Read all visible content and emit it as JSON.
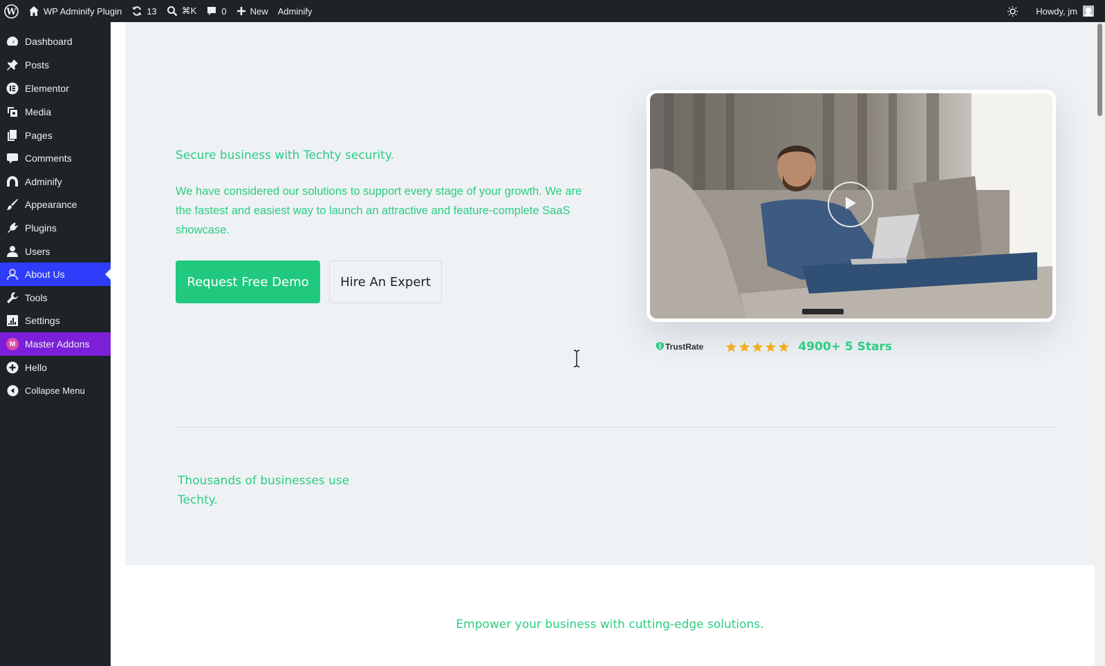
{
  "adminbar": {
    "site_name": "WP Adminify Plugin",
    "updates_count": "13",
    "search_shortcut": "⌘K",
    "comments_count": "0",
    "new_label": "New",
    "adminify_label": "Adminify",
    "greeting": "Howdy, jm"
  },
  "sidebar": {
    "items": [
      {
        "label": "Dashboard",
        "icon": "dashboard-icon"
      },
      {
        "label": "Posts",
        "icon": "pushpin-icon"
      },
      {
        "label": "Elementor",
        "icon": "elementor-icon"
      },
      {
        "label": "Media",
        "icon": "media-icon"
      },
      {
        "label": "Pages",
        "icon": "pages-icon"
      },
      {
        "label": "Comments",
        "icon": "comment-icon"
      },
      {
        "label": "Adminify",
        "icon": "adminify-icon"
      },
      {
        "label": "Appearance",
        "icon": "paintbrush-icon"
      },
      {
        "label": "Plugins",
        "icon": "plugin-icon"
      },
      {
        "label": "Users",
        "icon": "user-icon"
      },
      {
        "label": "About Us",
        "icon": "about-icon",
        "state": "active"
      },
      {
        "label": "Tools",
        "icon": "wrench-icon"
      },
      {
        "label": "Settings",
        "icon": "settings-icon"
      },
      {
        "label": "Master Addons",
        "icon": "master-addons-icon"
      },
      {
        "label": "Hello",
        "icon": "plus-circle-icon"
      },
      {
        "label": "Collapse Menu",
        "icon": "collapse-icon"
      }
    ],
    "master_badge": "M"
  },
  "hero": {
    "subtitle": "Secure business with Techty security.",
    "paragraph": "We have considered our solutions to support every stage of your growth. We are the fastest and easiest way to launch an attractive and feature-complete SaaS showcase.",
    "primary_button": "Request Free Demo",
    "secondary_button": "Hire An Expert",
    "trust_brand": "TrustRate",
    "rating": 5,
    "trust_text": "4900+ 5 Stars"
  },
  "clients": {
    "heading": "Thousands of businesses use Techty."
  },
  "features": {
    "heading": "Empower your business with cutting-edge solutions."
  },
  "colors": {
    "accent_green": "#2dcc83",
    "button_green": "#21c97e",
    "active_menu": "#2f3dfb",
    "master_addons": "#7b1fd8",
    "star": "#f6ad1e"
  }
}
